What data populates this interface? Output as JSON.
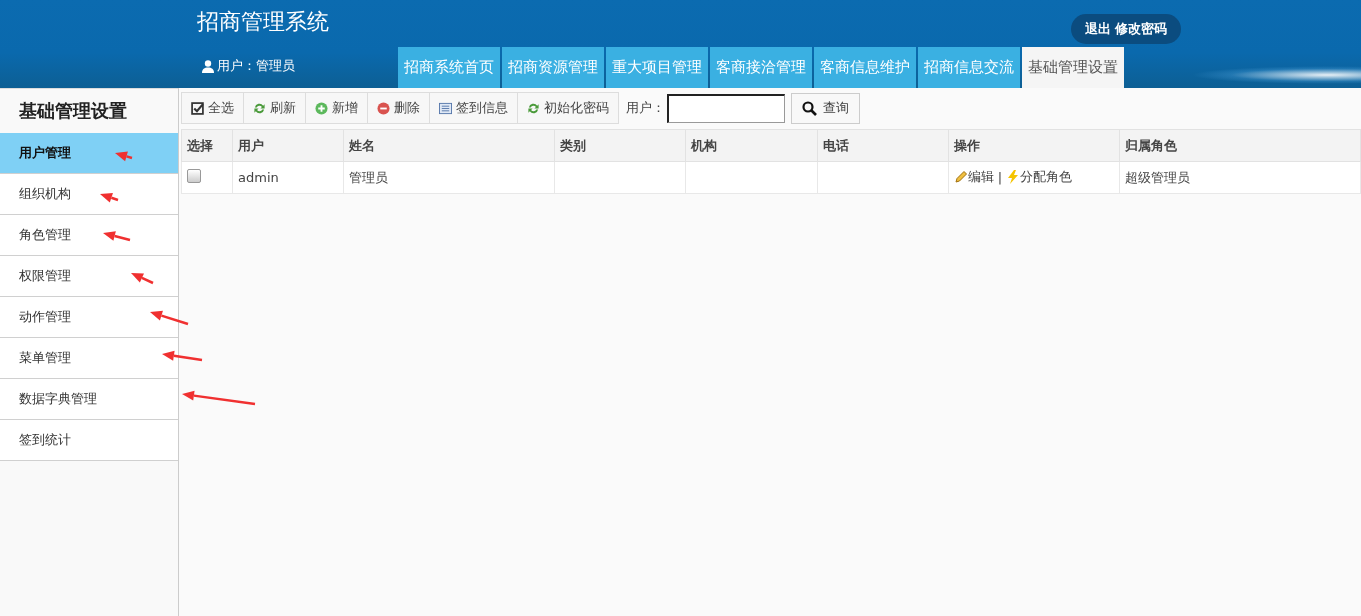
{
  "header": {
    "title": "招商管理系统",
    "user_label": "用户：管理员",
    "links": [
      "退出",
      "修改密码"
    ],
    "tabs": [
      {
        "label": "招商系统首页",
        "selected": false
      },
      {
        "label": "招商资源管理",
        "selected": false
      },
      {
        "label": "重大项目管理",
        "selected": false
      },
      {
        "label": "客商接洽管理",
        "selected": false
      },
      {
        "label": "客商信息维护",
        "selected": false
      },
      {
        "label": "招商信息交流",
        "selected": false
      },
      {
        "label": "基础管理设置",
        "selected": true
      }
    ]
  },
  "sidebar": {
    "title": "基础管理设置",
    "items": [
      {
        "label": "用户管理",
        "selected": true
      },
      {
        "label": "组织机构",
        "selected": false
      },
      {
        "label": "角色管理",
        "selected": false
      },
      {
        "label": "权限管理",
        "selected": false
      },
      {
        "label": "动作管理",
        "selected": false
      },
      {
        "label": "菜单管理",
        "selected": false
      },
      {
        "label": "数据字典管理",
        "selected": false
      },
      {
        "label": "签到统计",
        "selected": false
      }
    ]
  },
  "toolbar": {
    "buttons": [
      {
        "label": "全选",
        "kind": "check"
      },
      {
        "label": "刷新",
        "kind": "refresh"
      },
      {
        "label": "新增",
        "kind": "add"
      },
      {
        "label": "删除",
        "kind": "delete"
      },
      {
        "label": "签到信息",
        "kind": "list"
      },
      {
        "label": "初始化密码",
        "kind": "refresh"
      }
    ],
    "search_label": "用户：",
    "search_button": "查询"
  },
  "table": {
    "columns": [
      "选择",
      "用户",
      "姓名",
      "类别",
      "机构",
      "电话",
      "操作",
      "归属角色"
    ],
    "rows": [
      {
        "checked": false,
        "user": "admin",
        "name": "管理员",
        "actions": [
          {
            "label": "编辑",
            "kind": "edit"
          },
          {
            "label": "分配角色",
            "kind": "assign"
          }
        ],
        "separator": "|",
        "role": "超级管理员"
      }
    ]
  }
}
